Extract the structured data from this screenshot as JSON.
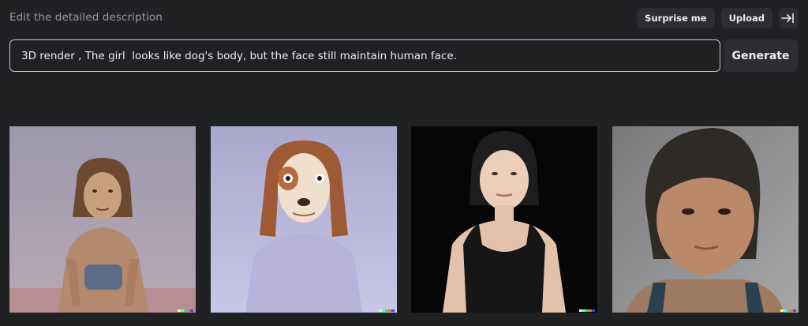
{
  "header": {
    "edit_label": "Edit the detailed description",
    "surprise_label": "Surprise me",
    "upload_label": "Upload"
  },
  "prompt": {
    "value": "3D render , The girl  looks like dog's body, but the face still maintain human face.",
    "generate_label": "Generate"
  },
  "icons": {
    "collapse": "arrow-right-to-bar-icon",
    "watermark": "color-strip-watermark"
  },
  "images": [
    {
      "subject": "dog-faced figure leaning forward, pink floor"
    },
    {
      "subject": "cartoon dog-faced girl in lavender top"
    },
    {
      "subject": "woman in black tank top on dark background"
    },
    {
      "subject": "close-up of girl with short dark hair"
    }
  ],
  "colors": {
    "background": "#202123",
    "button": "#2c2d31",
    "text": "#ececf1",
    "muted_text": "#9a9aa3",
    "watermark": [
      "#ffff66",
      "#42ffff",
      "#51da4c",
      "#ff6e3c",
      "#3c46ff"
    ]
  }
}
